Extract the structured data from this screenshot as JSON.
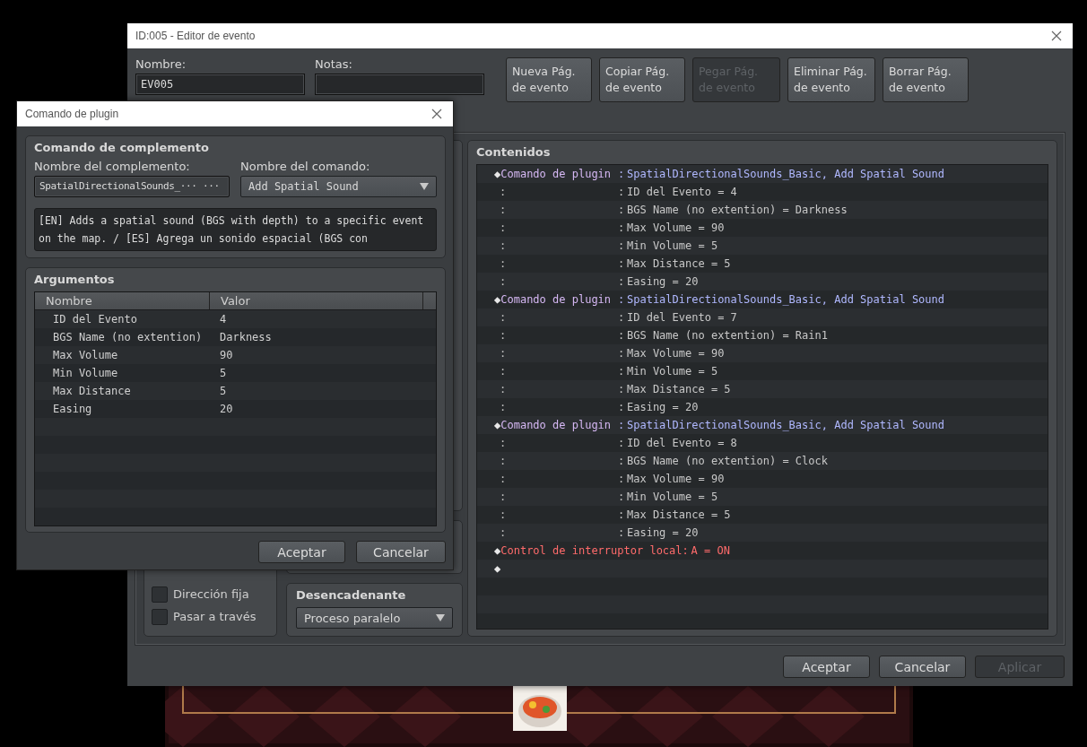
{
  "editor": {
    "title": "ID:005 - Editor de evento",
    "name": {
      "label": "Nombre:",
      "value": "EV005"
    },
    "notes": {
      "label": "Notas:"
    },
    "page_buttons": [
      {
        "label": "Nueva Pág. de evento",
        "disabled": false
      },
      {
        "label": "Copiar Pág. de evento",
        "disabled": false
      },
      {
        "label": "Pegar Pág. de evento",
        "disabled": true
      },
      {
        "label": "Eliminar Pág. de evento",
        "disabled": false
      },
      {
        "label": "Borrar Pág. de evento",
        "disabled": false
      }
    ],
    "options": [
      {
        "label": "Dirección fija",
        "checked": false
      },
      {
        "label": "Pasar a través",
        "checked": false
      }
    ],
    "trigger": {
      "title": "Desencadenante",
      "value": "Proceso paralelo"
    },
    "contents": {
      "title": "Contenidos",
      "rows": [
        {
          "kind": "command",
          "bullet": "◆",
          "label": "Comando de plugin",
          "separator": ":",
          "text": "SpatialDirectionalSounds_Basic, Add Spatial Sound"
        },
        {
          "kind": "param",
          "lead": ":",
          "separator": ":",
          "text": "ID del Evento = 4"
        },
        {
          "kind": "param",
          "lead": ":",
          "separator": ":",
          "text": "BGS Name (no extention) = Darkness"
        },
        {
          "kind": "param",
          "lead": ":",
          "separator": ":",
          "text": "Max Volume = 90"
        },
        {
          "kind": "param",
          "lead": ":",
          "separator": ":",
          "text": "Min Volume = 5"
        },
        {
          "kind": "param",
          "lead": ":",
          "separator": ":",
          "text": "Max Distance = 5"
        },
        {
          "kind": "param",
          "lead": ":",
          "separator": ":",
          "text": "Easing = 20"
        },
        {
          "kind": "command",
          "bullet": "◆",
          "label": "Comando de plugin",
          "separator": ":",
          "text": "SpatialDirectionalSounds_Basic, Add Spatial Sound"
        },
        {
          "kind": "param",
          "lead": ":",
          "separator": ":",
          "text": "ID del Evento = 7"
        },
        {
          "kind": "param",
          "lead": ":",
          "separator": ":",
          "text": "BGS Name (no extention) = Rain1"
        },
        {
          "kind": "param",
          "lead": ":",
          "separator": ":",
          "text": "Max Volume = 90"
        },
        {
          "kind": "param",
          "lead": ":",
          "separator": ":",
          "text": "Min Volume = 5"
        },
        {
          "kind": "param",
          "lead": ":",
          "separator": ":",
          "text": "Max Distance = 5"
        },
        {
          "kind": "param",
          "lead": ":",
          "separator": ":",
          "text": "Easing = 20"
        },
        {
          "kind": "command",
          "bullet": "◆",
          "label": "Comando de plugin",
          "separator": ":",
          "text": "SpatialDirectionalSounds_Basic, Add Spatial Sound"
        },
        {
          "kind": "param",
          "lead": ":",
          "separator": ":",
          "text": "ID del Evento = 8"
        },
        {
          "kind": "param",
          "lead": ":",
          "separator": ":",
          "text": "BGS Name (no extention) = Clock"
        },
        {
          "kind": "param",
          "lead": ":",
          "separator": ":",
          "text": "Max Volume = 90"
        },
        {
          "kind": "param",
          "lead": ":",
          "separator": ":",
          "text": "Min Volume = 5"
        },
        {
          "kind": "param",
          "lead": ":",
          "separator": ":",
          "text": "Max Distance = 5"
        },
        {
          "kind": "param",
          "lead": ":",
          "separator": ":",
          "text": "Easing = 20"
        },
        {
          "kind": "switch",
          "bullet": "◆",
          "label": "Control de interruptor local",
          "separator": ":",
          "text": "A = ON"
        },
        {
          "kind": "empty",
          "bullet": "◆"
        }
      ]
    },
    "buttons": [
      {
        "label": "Aceptar",
        "disabled": false
      },
      {
        "label": "Cancelar",
        "disabled": false
      },
      {
        "label": "Aplicar",
        "disabled": true
      }
    ]
  },
  "plugin_dialog": {
    "title": "Comando de plugin",
    "command_group": {
      "title": "Comando de complemento",
      "plugin_label": "Nombre del complemento:",
      "plugin_value": "SpatialDirectionalSounds_··· ···",
      "command_label": "Nombre del comando:",
      "command_value": "Add Spatial Sound",
      "description": "[EN] Adds a spatial sound (BGS with depth) to a specific event on the map. / [ES] Agrega un sonido espacial (BGS con"
    },
    "arguments": {
      "title": "Argumentos",
      "columns": [
        "Nombre",
        "Valor"
      ],
      "rows": [
        {
          "name": "ID del Evento",
          "value": "4"
        },
        {
          "name": "BGS Name (no extention)",
          "value": "Darkness"
        },
        {
          "name": "Max Volume",
          "value": "90"
        },
        {
          "name": "Min Volume",
          "value": "5"
        },
        {
          "name": "Max Distance",
          "value": "5"
        },
        {
          "name": "Easing",
          "value": "20"
        }
      ]
    },
    "buttons": [
      {
        "label": "Aceptar",
        "disabled": false
      },
      {
        "label": "Cancelar",
        "disabled": false
      }
    ]
  }
}
